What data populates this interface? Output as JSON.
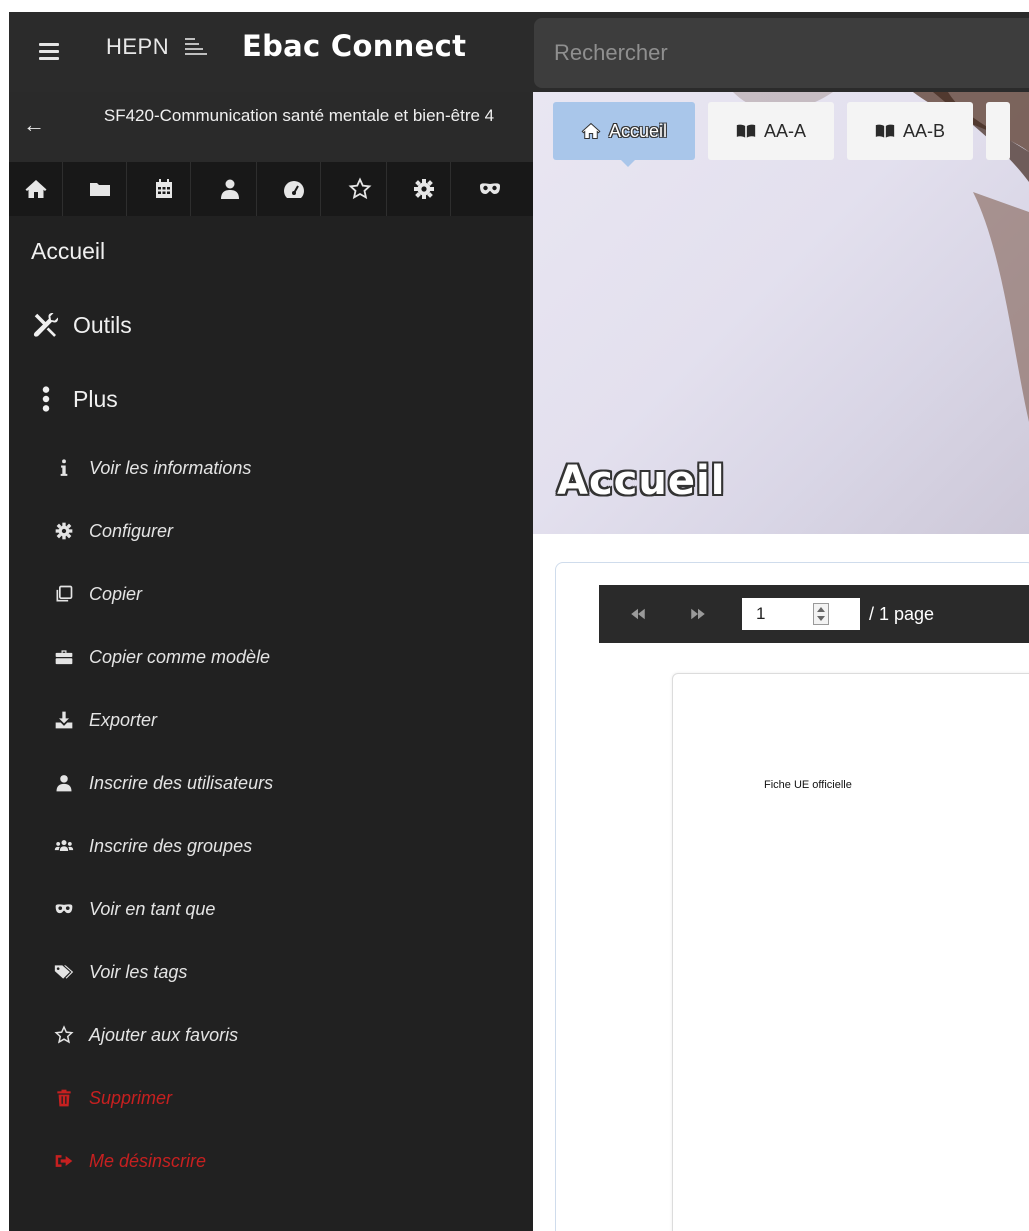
{
  "header": {
    "brand_hepn": "HEPN",
    "app_title": "Ebac Connect",
    "search_placeholder": "Rechercher"
  },
  "course": {
    "title": "SF420-Communication santé mentale et bien-être 4"
  },
  "icon_bar": [
    "home-icon",
    "folder-icon",
    "calendar-icon",
    "user-icon",
    "dashboard-icon",
    "star-icon",
    "gear-icon",
    "mask-icon"
  ],
  "nav": {
    "accueil": "Accueil",
    "outils": "Outils",
    "plus": "Plus"
  },
  "plus_items": [
    {
      "label": "Voir les informations",
      "icon": "info-icon"
    },
    {
      "label": "Configurer",
      "icon": "gear-icon"
    },
    {
      "label": "Copier",
      "icon": "copy-icon"
    },
    {
      "label": "Copier comme modèle",
      "icon": "briefcase-icon"
    },
    {
      "label": "Exporter",
      "icon": "download-icon"
    },
    {
      "label": "Inscrire des utilisateurs",
      "icon": "user-icon"
    },
    {
      "label": "Inscrire des groupes",
      "icon": "users-icon"
    },
    {
      "label": "Voir en tant que",
      "icon": "mask-icon"
    },
    {
      "label": "Voir les tags",
      "icon": "tags-icon"
    },
    {
      "label": "Ajouter aux favoris",
      "icon": "star-outline-icon"
    },
    {
      "label": "Supprimer",
      "icon": "trash-icon",
      "danger": true
    },
    {
      "label": "Me désinscrire",
      "icon": "sign-out-icon",
      "danger": true
    }
  ],
  "danger_color": "#c62020",
  "tabs": [
    {
      "label": "Accueil",
      "icon": "home-icon",
      "active": true
    },
    {
      "label": "AA-A",
      "icon": "book-icon"
    },
    {
      "label": "AA-B",
      "icon": "book-icon"
    }
  ],
  "banner": {
    "title": "Accueil"
  },
  "pdf": {
    "page_value": "1",
    "page_total": "/ 1 page",
    "page_text": "Fiche UE officielle"
  }
}
